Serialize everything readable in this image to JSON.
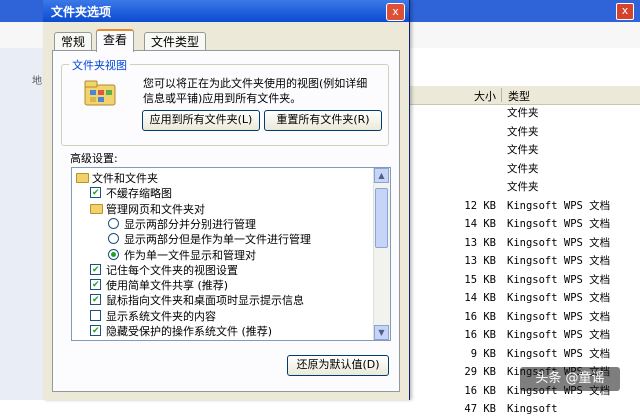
{
  "window": {
    "dialog_title": "文件夹选项",
    "close_glyph": "x",
    "columns": {
      "size": "大小",
      "type": "类型"
    },
    "rows": [
      {
        "size": "",
        "type": "文件夹"
      },
      {
        "size": "",
        "type": "文件夹"
      },
      {
        "size": "",
        "type": "文件夹"
      },
      {
        "size": "",
        "type": "文件夹"
      },
      {
        "size": "",
        "type": "文件夹"
      },
      {
        "size": "12 KB",
        "type": "Kingsoft WPS 文档"
      },
      {
        "size": "14 KB",
        "type": "Kingsoft WPS 文档"
      },
      {
        "size": "13 KB",
        "type": "Kingsoft WPS 文档"
      },
      {
        "size": "13 KB",
        "type": "Kingsoft WPS 文档"
      },
      {
        "size": "15 KB",
        "type": "Kingsoft WPS 文档"
      },
      {
        "size": "14 KB",
        "type": "Kingsoft WPS 文档"
      },
      {
        "size": "16 KB",
        "type": "Kingsoft WPS 文档"
      },
      {
        "size": "16 KB",
        "type": "Kingsoft WPS 文档"
      },
      {
        "size": "9 KB",
        "type": "Kingsoft WPS 文档"
      },
      {
        "size": "29 KB",
        "type": "Kingsoft WPS 文档"
      },
      {
        "size": "16 KB",
        "type": "Kingsoft WPS 文档"
      },
      {
        "size": "47 KB",
        "type": "Kingsoft"
      }
    ],
    "left_edge_text": "地",
    "watermark": "头条 @童谣"
  },
  "dialog": {
    "tabs": [
      "常规",
      "查看",
      "文件类型"
    ],
    "active_tab": "查看",
    "folder_views": {
      "legend": "文件夹视图",
      "description": "您可以将正在为此文件夹使用的视图(例如详细信息或平铺)应用到所有文件夹。",
      "apply_button": "应用到所有文件夹(L)",
      "reset_button": "重置所有文件夹(R)"
    },
    "advanced_label": "高级设置:",
    "tree": [
      {
        "kind": "folder",
        "checked": false,
        "label": "文件和文件夹"
      },
      {
        "kind": "checkbox",
        "checked": true,
        "label": "不缓存缩略图"
      },
      {
        "kind": "folder",
        "checked": false,
        "label": "管理网页和文件夹对"
      },
      {
        "kind": "radio",
        "checked": false,
        "label": "显示两部分并分别进行管理"
      },
      {
        "kind": "radio",
        "checked": false,
        "label": "显示两部分但是作为单一文件进行管理"
      },
      {
        "kind": "radio",
        "checked": true,
        "label": "作为单一文件显示和管理对"
      },
      {
        "kind": "checkbox",
        "checked": true,
        "label": "记住每个文件夹的视图设置"
      },
      {
        "kind": "checkbox",
        "checked": true,
        "label": "使用简单文件共享 (推荐)"
      },
      {
        "kind": "checkbox",
        "checked": true,
        "label": "鼠标指向文件夹和桌面项时显示提示信息"
      },
      {
        "kind": "checkbox",
        "checked": false,
        "label": "显示系统文件夹的内容"
      },
      {
        "kind": "checkbox",
        "checked": true,
        "label": "隐藏受保护的操作系统文件 (推荐)"
      }
    ],
    "restore_button": "还原为默认值(D)",
    "colors": {
      "accent": "#0046d5",
      "tab_highlight": "#e68b2c",
      "check_green": "#21a121",
      "dialog_bg": "#ece9d8"
    }
  }
}
